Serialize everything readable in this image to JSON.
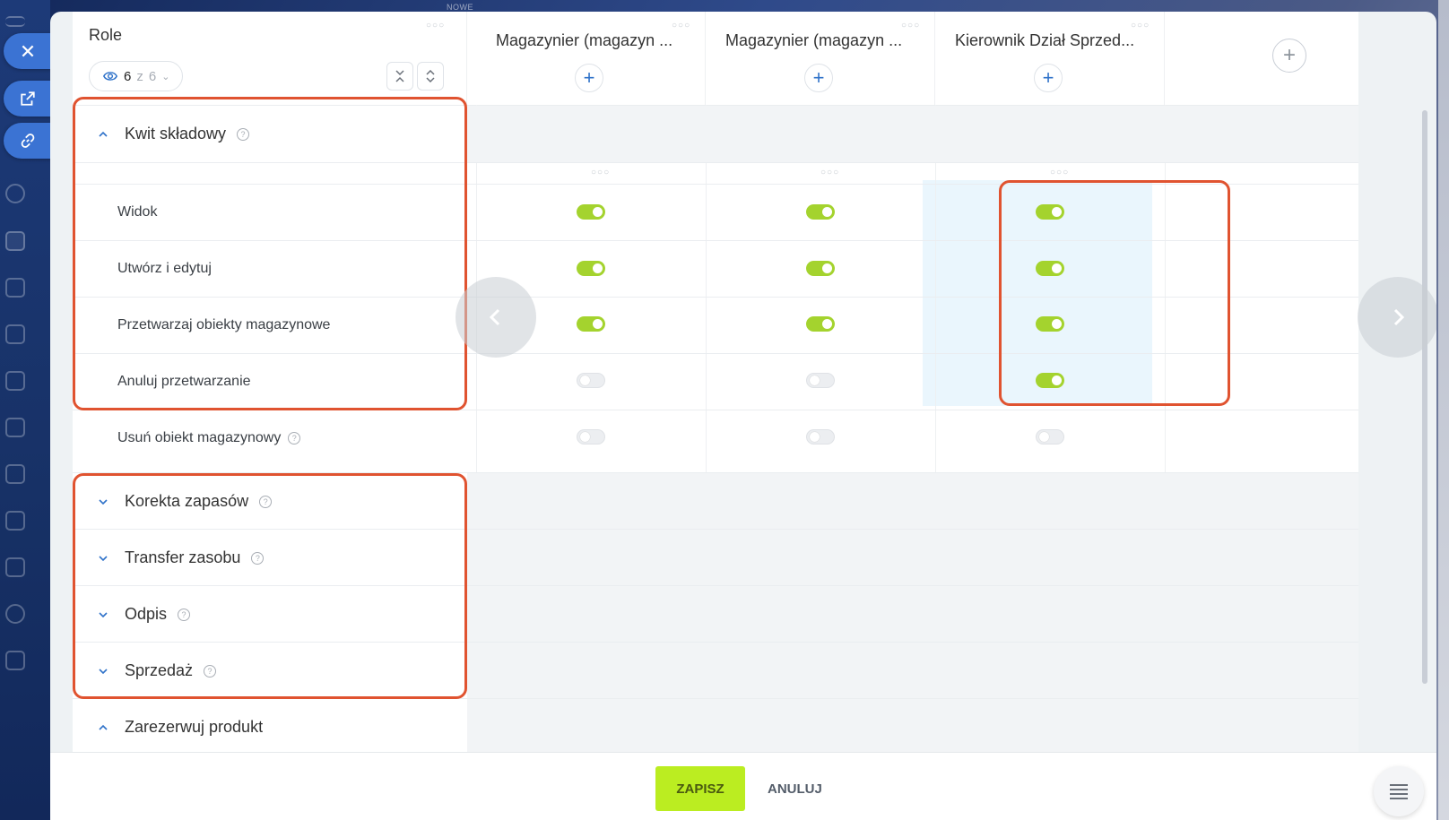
{
  "background": {
    "strip_label": "NOWE"
  },
  "header": {
    "role_title": "Role",
    "visibility": {
      "count": "6",
      "separator": "z",
      "total": "6"
    },
    "columns": [
      {
        "name": "Magazynier (magazyn ..."
      },
      {
        "name": "Magazynier (magazyn ..."
      },
      {
        "name": "Kierownik Dział Sprzed..."
      }
    ],
    "plus_symbol": "+",
    "add_role_symbol": "+"
  },
  "sections": {
    "kwit": {
      "label": "Kwit składowy",
      "expanded": true,
      "rows": [
        {
          "label": "Widok",
          "values": [
            true,
            true,
            true
          ]
        },
        {
          "label": "Utwórz i edytuj",
          "values": [
            true,
            true,
            true
          ]
        },
        {
          "label": "Przetwarzaj obiekty magazynowe",
          "values": [
            true,
            true,
            true
          ]
        },
        {
          "label": "Anuluj przetwarzanie",
          "values": [
            false,
            false,
            true
          ]
        },
        {
          "label": "Usuń obiekt magazynowy",
          "values": [
            false,
            false,
            false
          ]
        }
      ]
    },
    "korekta": {
      "label": "Korekta zapasów",
      "expanded": false
    },
    "transfer": {
      "label": "Transfer zasobu",
      "expanded": false
    },
    "odpis": {
      "label": "Odpis",
      "expanded": false
    },
    "sprzedaz": {
      "label": "Sprzedaż",
      "expanded": false
    },
    "rezerwuj": {
      "label": "Zarezerwuj produkt",
      "expanded": true
    }
  },
  "help_symbol": "?",
  "footer": {
    "save_label": "ZAPISZ",
    "cancel_label": "ANULUJ"
  },
  "colors": {
    "toggle_on": "#a4d32e",
    "save_button": "#bbed21",
    "accent_blue": "#2f72c9",
    "annotation": "#e05330",
    "highlight": "#eaf6fd"
  }
}
